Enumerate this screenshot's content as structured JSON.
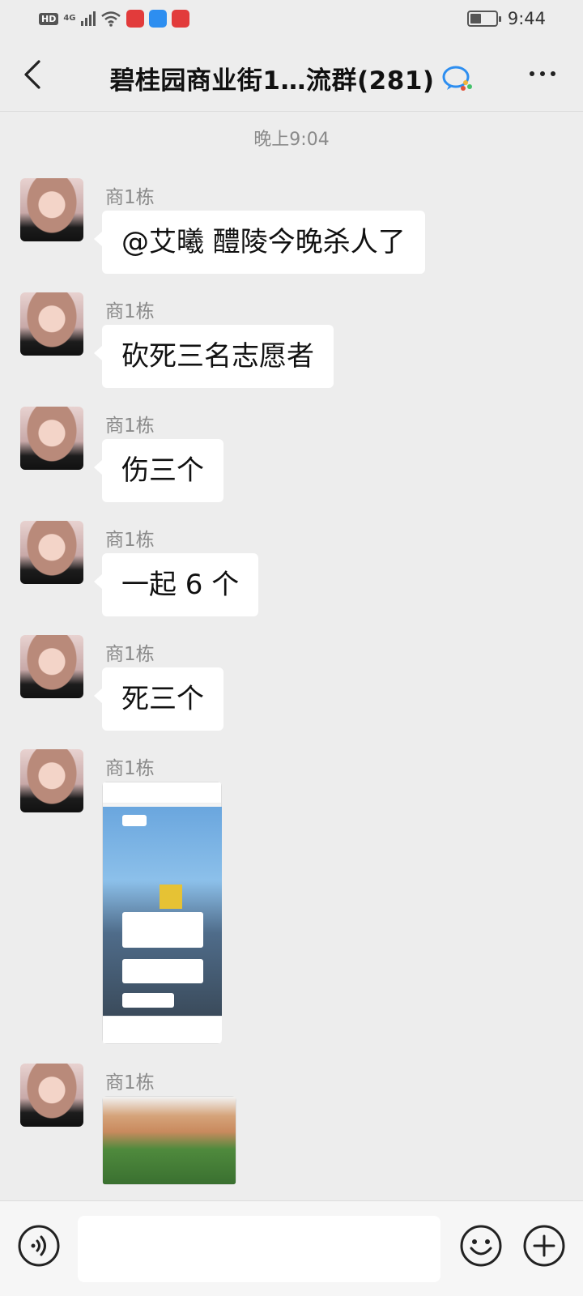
{
  "status_bar": {
    "hd": "HD",
    "network": "4G",
    "time": "9:44",
    "battery_level": 0.45
  },
  "header": {
    "title": "碧桂园商业街1…流群(281)",
    "back_icon": "chevron-left-icon",
    "more_icon": "more-horizontal-icon"
  },
  "chat": {
    "timestamp": "晚上9:04",
    "messages": [
      {
        "sender": "商1栋",
        "type": "text",
        "text": "@艾曦  醴陵今晚杀人了"
      },
      {
        "sender": "商1栋",
        "type": "text",
        "text": "砍死三名志愿者"
      },
      {
        "sender": "商1栋",
        "type": "text",
        "text": "伤三个"
      },
      {
        "sender": "商1栋",
        "type": "text",
        "text": "一起 6 个"
      },
      {
        "sender": "商1栋",
        "type": "text",
        "text": "死三个"
      },
      {
        "sender": "商1栋",
        "type": "image"
      },
      {
        "sender": "商1栋",
        "type": "image"
      }
    ]
  },
  "input_bar": {
    "placeholder": "",
    "voice_icon": "voice-icon",
    "emoji_icon": "emoji-icon",
    "plus_icon": "plus-icon"
  }
}
